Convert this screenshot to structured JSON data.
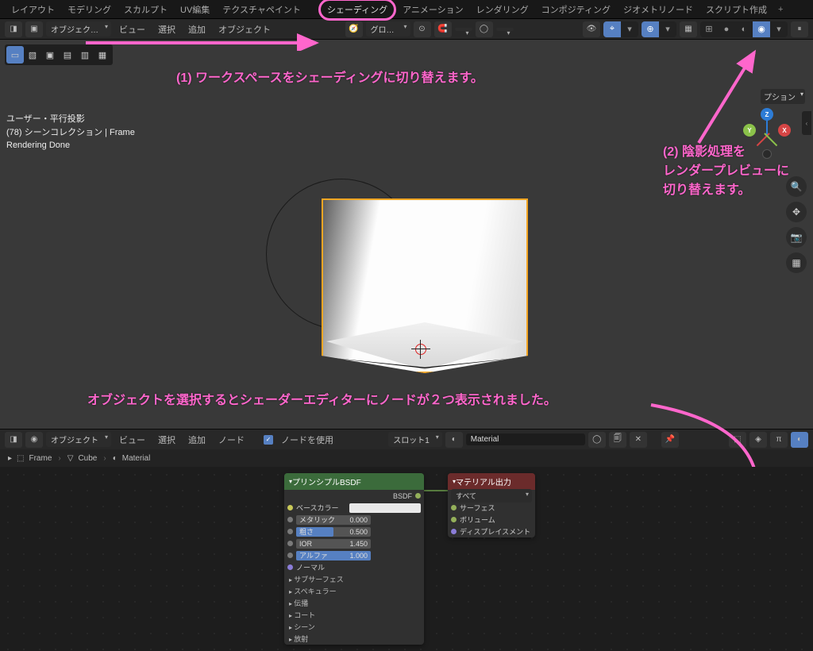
{
  "topTabs": [
    "レイアウト",
    "モデリング",
    "スカルプト",
    "UV編集",
    "テクスチャペイント",
    "シェーディング",
    "アニメーション",
    "レンダリング",
    "コンポジティング",
    "ジオメトリノード",
    "スクリプト作成"
  ],
  "hdr2": {
    "mode": "オブジェク…",
    "view": "ビュー",
    "select": "選択",
    "add": "追加",
    "object": "オブジェクト",
    "orient": "グロ…",
    "options": "プション"
  },
  "vinfo": {
    "l1": "ユーザー・平行投影",
    "l2": "(78) シーンコレクション | Frame",
    "l3": "Rendering Done"
  },
  "anno": {
    "a1": "(1) ワークスペースをシェーディングに切り替えます。",
    "a2a": "(2) 陰影処理を",
    "a2b": "レンダープレビューに",
    "a2c": "切り替えます。",
    "a3": "オブジェクトを選択するとシェーダーエディターにノードが２つ表示されました。"
  },
  "shaderHdr": {
    "mode": "オブジェクト",
    "view": "ビュー",
    "select": "選択",
    "add": "追加",
    "node": "ノード",
    "useNodes": "ノードを使用",
    "slot": "スロット1",
    "mat": "Material"
  },
  "breadcrumb": [
    "Frame",
    "Cube",
    "Material"
  ],
  "node1": {
    "title": "プリンシプルBSDF",
    "out": "BSDF",
    "rows": [
      {
        "label": "ベースカラー",
        "type": "color"
      },
      {
        "label": "メタリック",
        "val": "0.000",
        "fill": 0
      },
      {
        "label": "粗さ",
        "val": "0.500",
        "fill": 50
      },
      {
        "label": "IOR",
        "val": "1.450",
        "fill": 0
      },
      {
        "label": "アルファ",
        "val": "1.000",
        "fill": 100
      }
    ],
    "expand": [
      "ノーマル",
      "サブサーフェス",
      "スペキュラー",
      "伝播",
      "コート",
      "シーン",
      "放射"
    ]
  },
  "node2": {
    "title": "マテリアル出力",
    "dd": "すべて",
    "ins": [
      "サーフェス",
      "ボリューム",
      "ディスプレイスメント"
    ]
  },
  "gizmo": {
    "x": "X",
    "y": "Y",
    "z": "Z"
  }
}
